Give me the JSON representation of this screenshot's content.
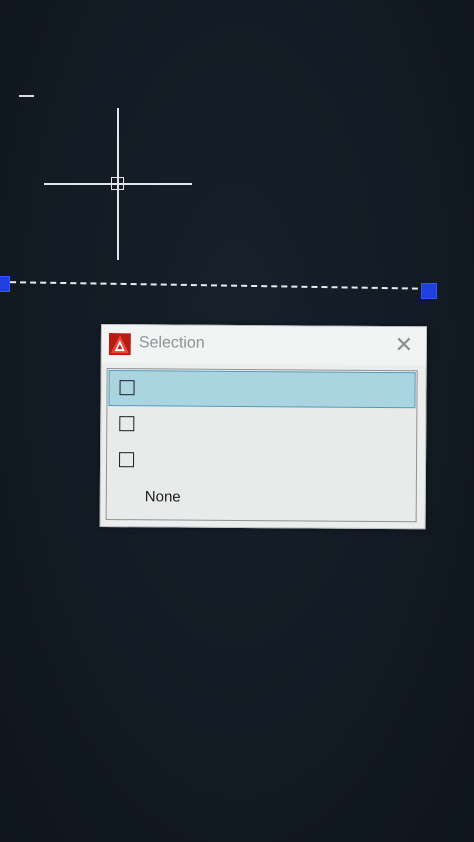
{
  "dialog": {
    "title": "Selection",
    "close_glyph": "✕",
    "icon": "autocad-logo-icon",
    "items": [
      {
        "label": "",
        "selected": true,
        "has_checkbox": true
      },
      {
        "label": "",
        "selected": false,
        "has_checkbox": true
      },
      {
        "label": "",
        "selected": false,
        "has_checkbox": true
      },
      {
        "label": "None",
        "selected": false,
        "has_checkbox": false
      }
    ]
  },
  "drawing": {
    "selected_object": "dashed-line",
    "grip_color": "#1f3fe0",
    "background_color": "#121a24"
  },
  "colors": {
    "selected_row": "#a9d4e0",
    "title_text": "#8e9397",
    "logo_red": "#d8281c"
  }
}
